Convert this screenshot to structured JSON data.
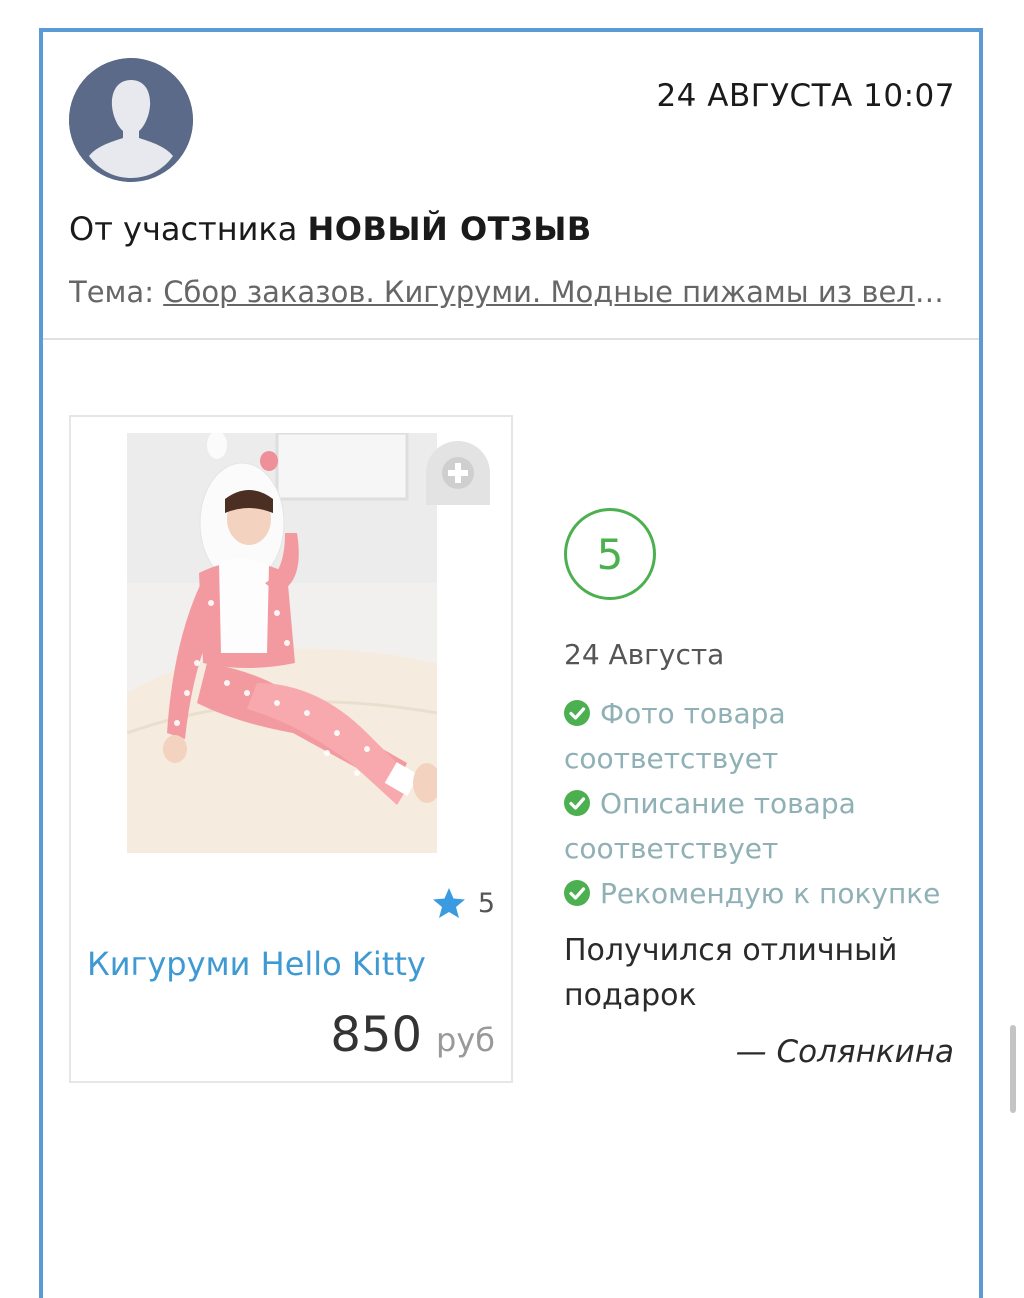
{
  "header": {
    "timestamp": "24 АВГУСТА 10:07",
    "from_prefix": "От участника",
    "from_user": "НОВЫЙ ОТЗЫВ",
    "topic_label": "Тема:",
    "topic_link": "Сбор заказов. Кигуруми. Модные пижамы из велсофта"
  },
  "product": {
    "name": "Кигуруми Hello Kitty",
    "rating": "5",
    "price": "850",
    "currency": "руб"
  },
  "review": {
    "score": "5",
    "date": "24 Августа",
    "checks": [
      "Фото товара соответствует",
      "Описание товара соответствует",
      "Рекомендую к покупке"
    ],
    "comment": "Получился отличный подарок",
    "author": "— Солянкина"
  },
  "colors": {
    "frame_border": "#5b9bd5",
    "link_blue": "#3f99d3",
    "score_green": "#4cb050",
    "check_text": "#8fb0b5",
    "star_blue": "#3a9be0"
  }
}
